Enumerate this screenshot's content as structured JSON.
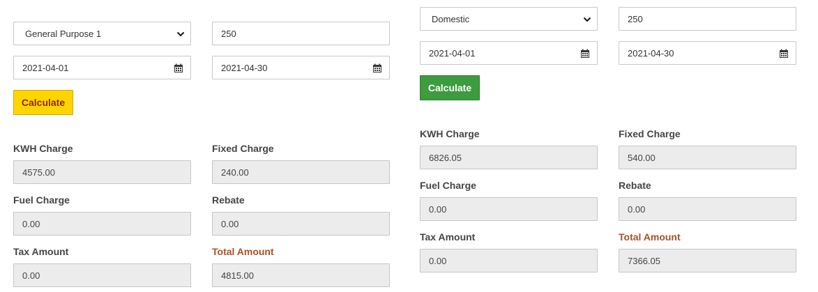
{
  "left": {
    "category": "General Purpose 1",
    "units": "250",
    "from_date": "2021-04-01",
    "to_date": "2021-04-30",
    "calculate_label": "Calculate",
    "results": {
      "kwh_charge_label": "KWH Charge",
      "kwh_charge": "4575.00",
      "fixed_charge_label": "Fixed Charge",
      "fixed_charge": "240.00",
      "fuel_charge_label": "Fuel Charge",
      "fuel_charge": "0.00",
      "rebate_label": "Rebate",
      "rebate": "0.00",
      "tax_amount_label": "Tax Amount",
      "tax_amount": "0.00",
      "total_amount_label": "Total Amount",
      "total_amount": "4815.00"
    }
  },
  "right": {
    "category": "Domestic",
    "units": "250",
    "from_date": "2021-04-01",
    "to_date": "2021-04-30",
    "calculate_label": "Calculate",
    "results": {
      "kwh_charge_label": "KWH Charge",
      "kwh_charge": "6826.05",
      "fixed_charge_label": "Fixed Charge",
      "fixed_charge": "540.00",
      "fuel_charge_label": "Fuel Charge",
      "fuel_charge": "0.00",
      "rebate_label": "Rebate",
      "rebate": "0.00",
      "tax_amount_label": "Tax Amount",
      "tax_amount": "0.00",
      "total_amount_label": "Total Amount",
      "total_amount": "7366.05"
    }
  },
  "colors": {
    "yellow_button": "#ffd500",
    "green_button": "#3e9b3e",
    "total_label": "#a9502a",
    "readonly_bg": "#ececec"
  },
  "icons": {
    "select": "chevron-down-icon",
    "date": "calendar-icon"
  }
}
